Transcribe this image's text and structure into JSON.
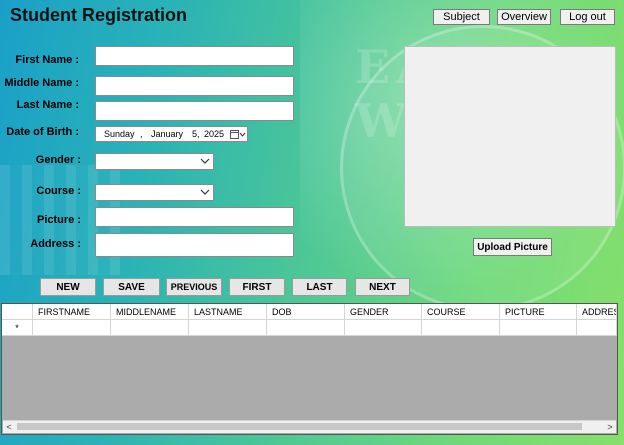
{
  "app": {
    "title": "Student Registration"
  },
  "header": {
    "subject_label": "Subject",
    "overview_label": "Overview",
    "logout_label": "Log out"
  },
  "background": {
    "watermark_text": "EAST WOODS"
  },
  "form": {
    "first_name_label": "First Name :",
    "middle_name_label": "Middle Name :",
    "last_name_label": "Last Name :",
    "dob_label": "Date of Birth :",
    "gender_label": "Gender :",
    "course_label": "Course :",
    "picture_label": "Picture :",
    "address_label": "Address :",
    "first_name_value": "",
    "middle_name_value": "",
    "last_name_value": "",
    "gender_value": "",
    "course_value": "",
    "picture_value": "",
    "address_value": "",
    "dob": {
      "weekday": "Sunday",
      "sep": ",",
      "month": "January",
      "day": "5,",
      "year": "2025"
    }
  },
  "picture_panel": {
    "upload_label": "Upload Picture"
  },
  "nav_buttons": {
    "new": "NEW",
    "save": "SAVE",
    "previous": "PREVIOUS",
    "first": "FIRST",
    "last": "LAST",
    "next": "NEXT"
  },
  "grid": {
    "columns": [
      "FIRSTNAME",
      "MIDDLENAME",
      "LASTNAME",
      "DOB",
      "GENDER",
      "COURSE",
      "PICTURE",
      "ADDRESS"
    ],
    "new_row_marker": "*",
    "scroll_left": "<",
    "scroll_right": ">"
  },
  "colors": {
    "gradient_start": "#1aa0c8",
    "gradient_end": "#86e06a",
    "grid_empty": "#ababab"
  },
  "icons": {
    "calendar": "calendar-icon",
    "dropdown": "chevron-down-icon"
  }
}
